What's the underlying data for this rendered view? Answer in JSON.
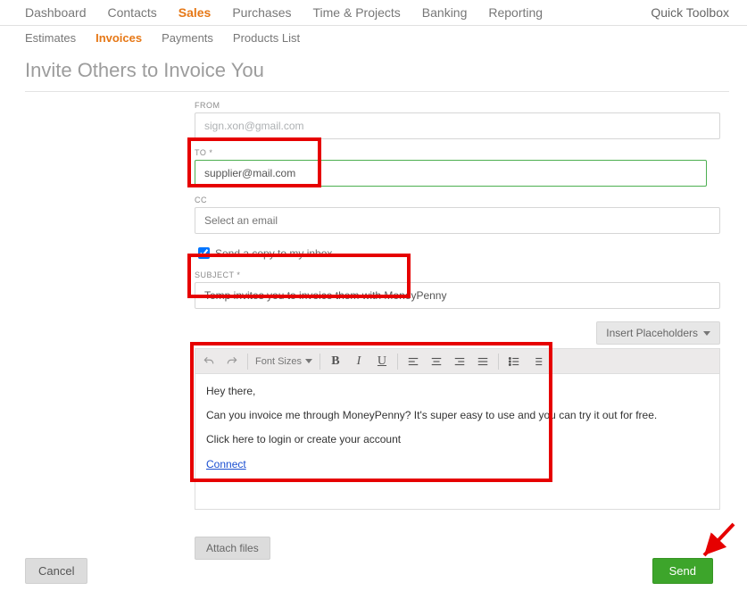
{
  "nav": {
    "items": [
      "Dashboard",
      "Contacts",
      "Sales",
      "Purchases",
      "Time & Projects",
      "Banking",
      "Reporting"
    ],
    "toolbox": "Quick Toolbox"
  },
  "subnav": {
    "items": [
      "Estimates",
      "Invoices",
      "Payments",
      "Products List"
    ]
  },
  "page": {
    "title": "Invite Others to Invoice You"
  },
  "form": {
    "from_label": "FROM",
    "from_value": "sign.xon@gmail.com",
    "to_label": "TO *",
    "to_value": "supplier@mail.com",
    "cc_label": "CC",
    "cc_placeholder": "Select an email",
    "send_copy_label": "Send a copy to my inbox",
    "send_copy_checked": true,
    "subject_label": "SUBJECT *",
    "subject_value": "Temp invites you to invoice them with MoneyPenny",
    "placeholders_btn": "Insert Placeholders",
    "attach_btn": "Attach files"
  },
  "toolbar": {
    "font_sizes": "Font Sizes"
  },
  "editor": {
    "line1": "Hey there,",
    "line2": "Can you invoice me through MoneyPenny? It's super easy to use and you can try it out for free.",
    "line3": "Click here to login or create your account",
    "link": "Connect"
  },
  "footer": {
    "cancel": "Cancel",
    "send": "Send"
  }
}
